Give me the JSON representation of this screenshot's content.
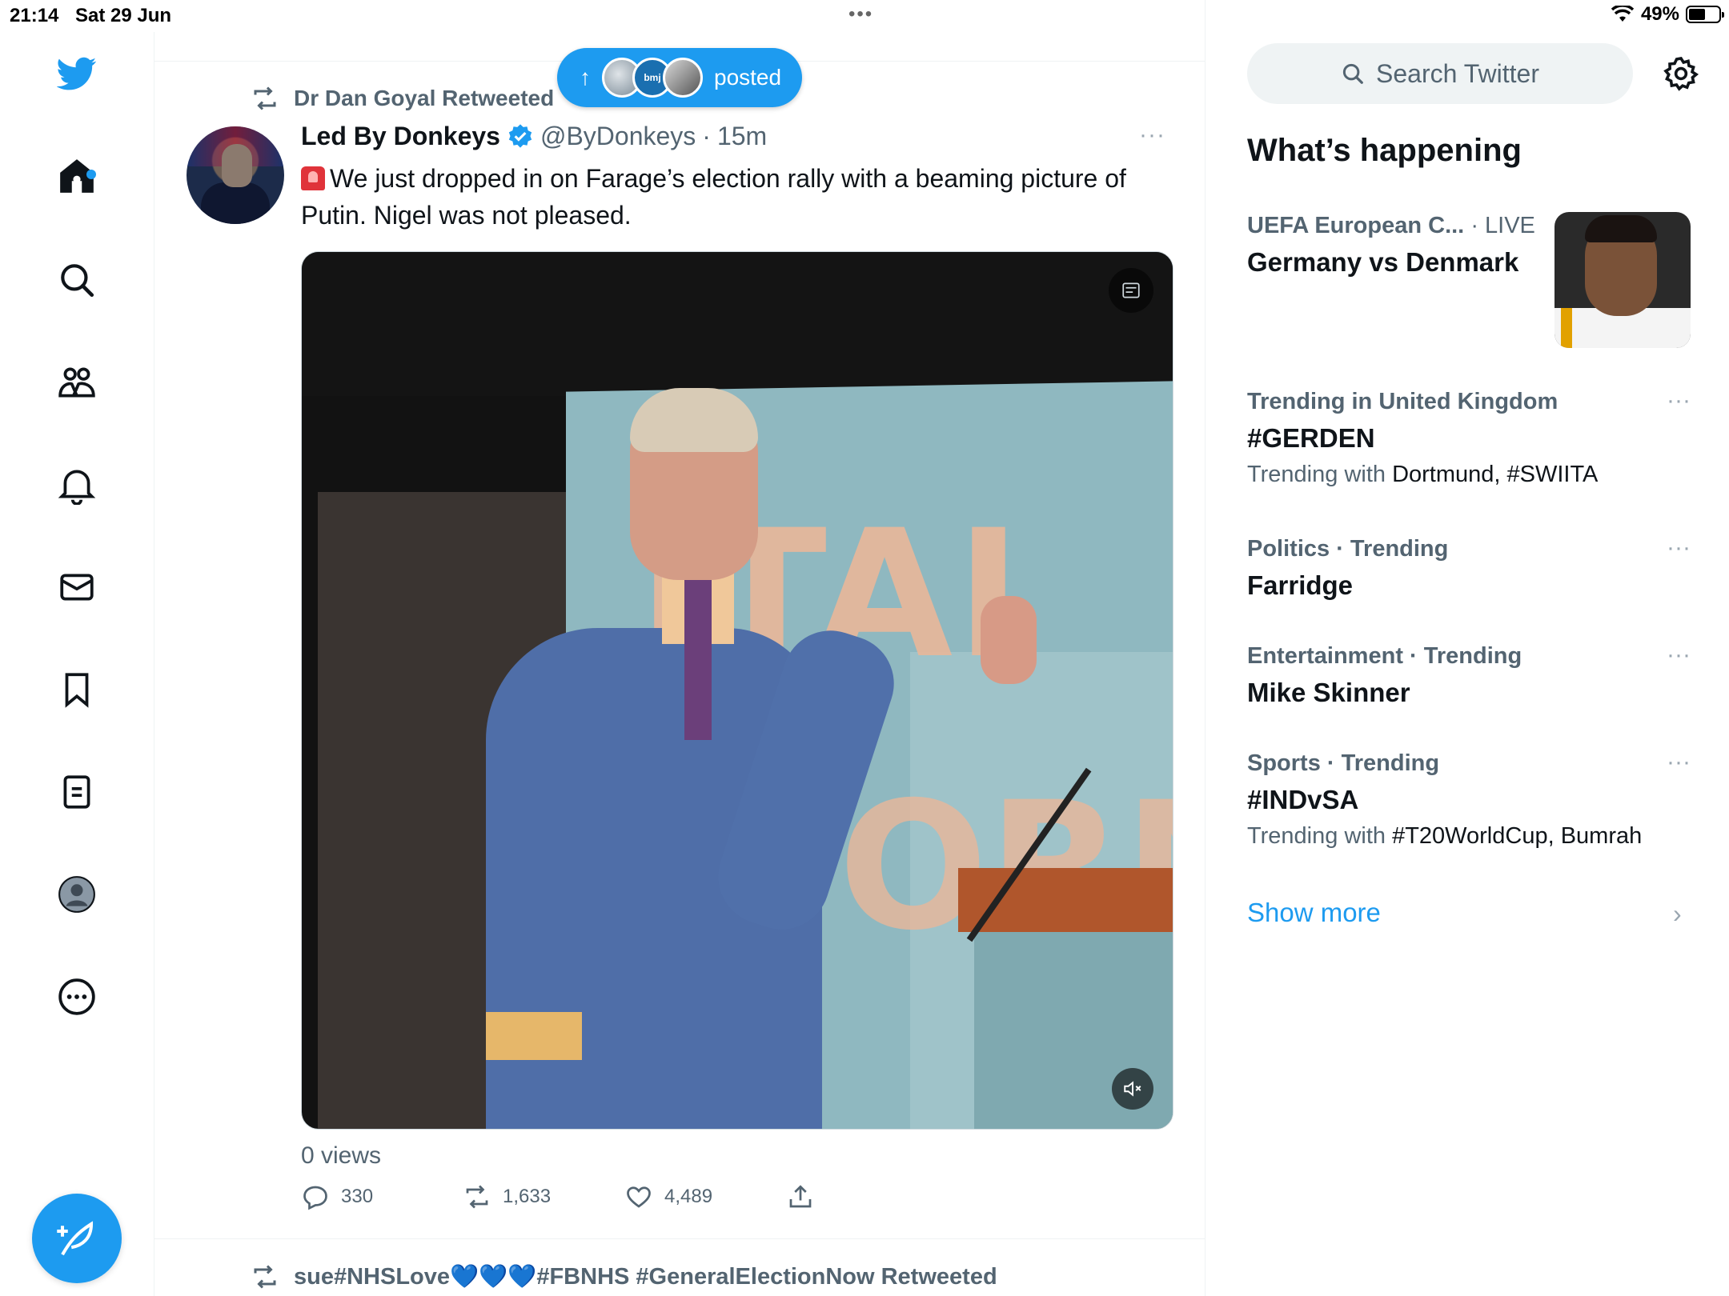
{
  "status_bar": {
    "time": "21:14",
    "date": "Sat 29 Jun",
    "battery": "49%",
    "battery_level": 0.49
  },
  "nav": {
    "items": [
      "home-icon",
      "search-icon",
      "communities-icon",
      "notifications-icon",
      "messages-icon",
      "bookmarks-icon",
      "lists-icon",
      "profile-icon",
      "more-icon"
    ],
    "compose_icon": "compose-feather-icon"
  },
  "new_posts_pill": {
    "label": "posted",
    "avatar_text": "bmj"
  },
  "tweet": {
    "retweeted_by": "Dr Dan Goyal Retweeted",
    "author_name": "Led By Donkeys",
    "author_handle": "@ByDonkeys",
    "separator": "·",
    "time": "15m",
    "text": "We just dropped in on Farage’s election rally with a beaming picture of Putin. Nigel was not pleased.",
    "media_text_top": "ITAI",
    "media_text_bottom": "FORM",
    "views": "0 views",
    "replies": "330",
    "retweets": "1,633",
    "likes": "4,489"
  },
  "next_tweet": {
    "retweeted_by_prefix": "sue#NHSLove",
    "hearts": "💙💙💙",
    "retweeted_by_suffix": "#FBNHS #GeneralElectionNow Retweeted"
  },
  "sidebar": {
    "search_placeholder": "Search Twitter",
    "whats_happening": "What’s happening",
    "trends": [
      {
        "category": "UEFA European C...",
        "live": "· LIVE",
        "title": "Germany vs Denmark"
      },
      {
        "category": "Trending in United Kingdom",
        "title": "#GERDEN",
        "sub_prefix": "Trending with",
        "sub_items": "Dortmund, #SWIITA"
      },
      {
        "category": "Politics · Trending",
        "title": "Farridge"
      },
      {
        "category": "Entertainment · Trending",
        "title": "Mike Skinner"
      },
      {
        "category": "Sports · Trending",
        "title": "#INDvSA",
        "sub_prefix": "Trending with",
        "sub_items": "#T20WorldCup, Bumrah"
      }
    ],
    "show_more": "Show more",
    "more_dots": "···",
    "chevron": "›"
  },
  "colors": {
    "accent": "#1d9bf0",
    "text": "#0f1419",
    "secondary": "#536471"
  }
}
